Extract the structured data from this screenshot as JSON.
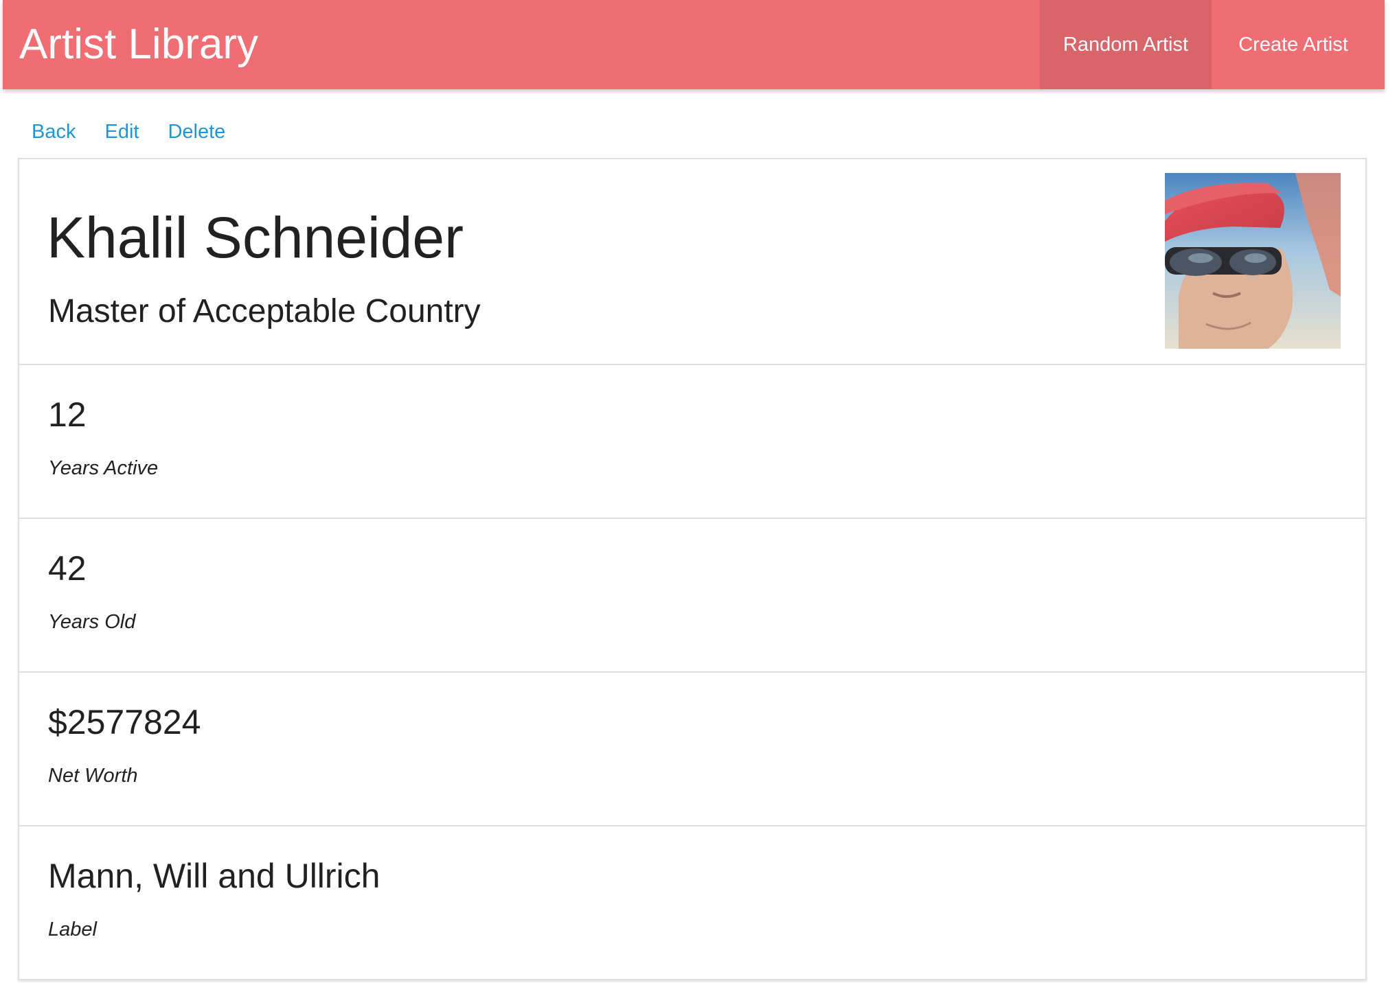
{
  "app": {
    "title": "Artist Library",
    "brand_color": "#ef6e73",
    "link_color": "#1e95d4"
  },
  "navbar": {
    "random_label": "Random Artist",
    "create_label": "Create Artist"
  },
  "actions": {
    "back_label": "Back",
    "edit_label": "Edit",
    "delete_label": "Delete"
  },
  "artist": {
    "name": "Khalil Schneider",
    "title": "Master of Acceptable Country",
    "avatar_icon": "avatar-photo"
  },
  "stats": [
    {
      "value": "12",
      "label": "Years Active"
    },
    {
      "value": "42",
      "label": "Years Old"
    },
    {
      "value": "$2577824",
      "label": "Net Worth"
    },
    {
      "value": "Mann, Will and Ullrich",
      "label": "Label"
    }
  ]
}
